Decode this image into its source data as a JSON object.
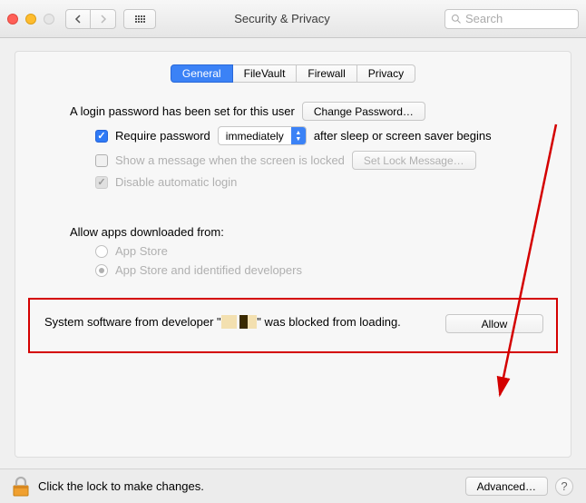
{
  "window": {
    "title": "Security & Privacy",
    "search_placeholder": "Search"
  },
  "tabs": {
    "general": "General",
    "filevault": "FileVault",
    "firewall": "Firewall",
    "privacy": "Privacy"
  },
  "login": {
    "password_set_text": "A login password has been set for this user",
    "change_password_btn": "Change Password…",
    "require_password_label": "Require password",
    "require_password_select": "immediately",
    "require_password_suffix": "after sleep or screen saver begins",
    "show_message_label": "Show a message when the screen is locked",
    "set_lock_message_btn": "Set Lock Message…",
    "disable_auto_login_label": "Disable automatic login"
  },
  "gatekeeper": {
    "heading": "Allow apps downloaded from:",
    "option_appstore": "App Store",
    "option_identified": "App Store and identified developers"
  },
  "blocked": {
    "prefix": "System software from developer \"",
    "suffix": "\" was blocked from loading.",
    "allow_btn": "Allow"
  },
  "footer": {
    "lock_text": "Click the lock to make changes.",
    "advanced_btn": "Advanced…"
  }
}
